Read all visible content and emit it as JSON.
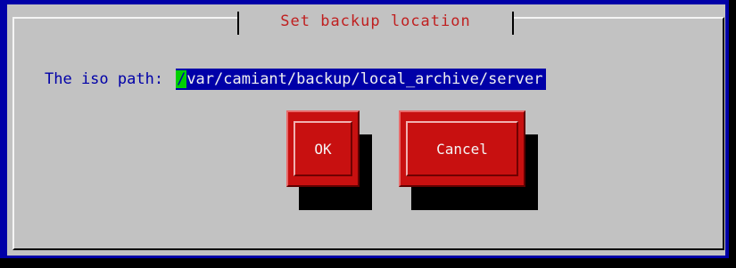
{
  "dialog": {
    "title": "Set backup location",
    "path_label": "The iso path:",
    "path_first_char": "/",
    "path_rest": "var/camiant/backup/local_archive/server"
  },
  "buttons": {
    "ok_label": "OK",
    "cancel_label": "Cancel"
  },
  "colors": {
    "background_blue": "#0000a8",
    "dialog_gray": "#c2c2c2",
    "title_red": "#c02020",
    "button_red": "#c81010",
    "cursor_green": "#00d000"
  }
}
